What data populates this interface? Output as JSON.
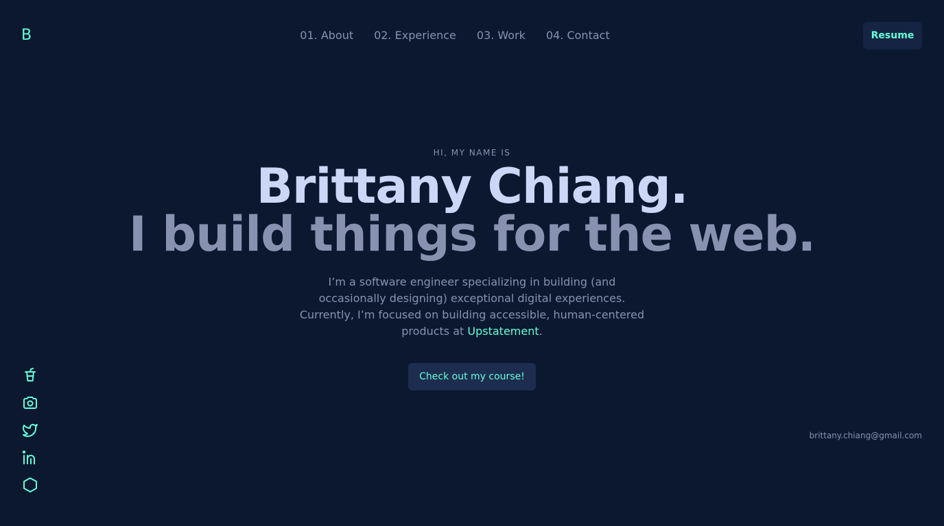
{
  "logo": {
    "text": "B"
  },
  "nav": {
    "items": [
      {
        "label": "01. About"
      },
      {
        "label": "02. Experience"
      },
      {
        "label": "03. Work"
      },
      {
        "label": "04. Contact"
      }
    ],
    "resume_label": "Resume"
  },
  "hero": {
    "intro": "HI, MY NAME IS",
    "name": "Brittany Chiang.",
    "tagline": "I build things for the web.",
    "bio_before": "I’m a software engineer specializing in building (and occasionally designing) exceptional digital experiences. Currently, I’m focused on building accessible, human-centered products at ",
    "bio_link": "Upstatement",
    "bio_after": ".",
    "cta_label": "Check out my course!"
  },
  "social": {
    "icons": [
      "cup-icon",
      "camera-icon",
      "twitter-icon",
      "linkedin-icon",
      "codepen-icon"
    ]
  },
  "email": "brittany.chiang@gmail.com",
  "colors": {
    "background": "#0b1830",
    "accent": "#64ffda",
    "heading": "#ccd6f6",
    "text": "#8892b0",
    "button_bg": "#1d2d50"
  }
}
